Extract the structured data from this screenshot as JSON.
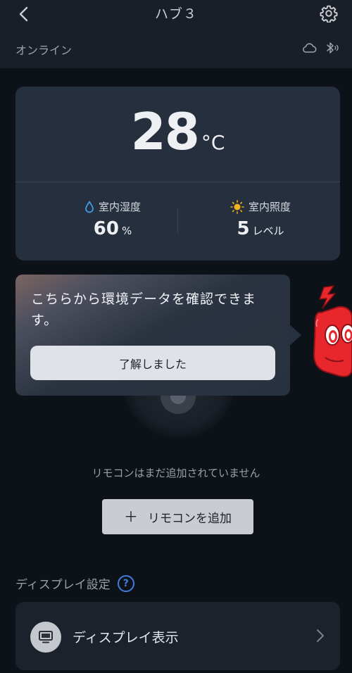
{
  "header": {
    "title": "ハブ３",
    "status": "オンライン",
    "icons": {
      "back": "chevron-left-icon",
      "settings": "gear-icon",
      "cloud": "cloud-icon",
      "bluetooth": "bluetooth-icon"
    }
  },
  "environment": {
    "temperature": "28",
    "temperature_unit": "°C",
    "humidity": {
      "label": "室内湿度",
      "value": "60",
      "unit": "%",
      "icon": "water-drop-icon"
    },
    "illuminance": {
      "label": "室内照度",
      "value": "5",
      "unit": "レベル",
      "icon": "sun-icon"
    }
  },
  "tooltip": {
    "message": "こちらから環境データを確認できます。",
    "confirm_label": "了解しました"
  },
  "remote": {
    "empty_text": "リモコンはまだ追加されていません",
    "add_label": "リモコンを追加",
    "plus": "＋"
  },
  "display_section": {
    "title": "ディスプレイ設定",
    "help": "?",
    "item_label": "ディスプレイ表示",
    "item_icon": "monitor-icon"
  },
  "colors": {
    "accent_blue": "#3f7de0",
    "sun_orange": "#f2b21b",
    "mascot_red": "#e8272d"
  }
}
